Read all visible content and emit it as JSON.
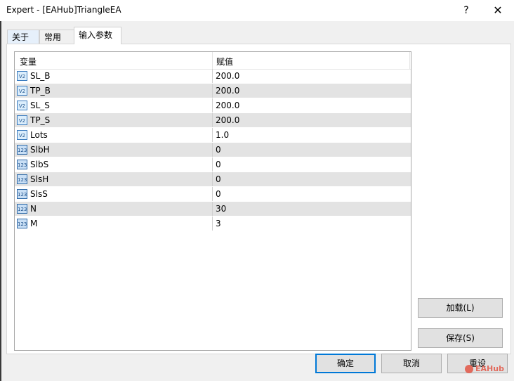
{
  "window": {
    "title": "Expert - [EAHub]TriangleEA",
    "help_label": "?",
    "close_label": "✕"
  },
  "tabs": [
    {
      "label": "关于"
    },
    {
      "label": "常用"
    },
    {
      "label": "输入参数"
    }
  ],
  "table": {
    "columns": [
      "变量",
      "赋值"
    ],
    "rows": [
      {
        "name": "SL_B",
        "value": "200.0",
        "icon": "double-param-icon",
        "icon_text": "V2"
      },
      {
        "name": "TP_B",
        "value": "200.0",
        "icon": "double-param-icon",
        "icon_text": "V2"
      },
      {
        "name": "SL_S",
        "value": "200.0",
        "icon": "double-param-icon",
        "icon_text": "V2"
      },
      {
        "name": "TP_S",
        "value": "200.0",
        "icon": "double-param-icon",
        "icon_text": "V2"
      },
      {
        "name": "Lots",
        "value": "1.0",
        "icon": "double-param-icon",
        "icon_text": "V2"
      },
      {
        "name": "SlbH",
        "value": "0",
        "icon": "integer-param-icon",
        "icon_text": "123"
      },
      {
        "name": "SlbS",
        "value": "0",
        "icon": "integer-param-icon",
        "icon_text": "123"
      },
      {
        "name": "SlsH",
        "value": "0",
        "icon": "integer-param-icon",
        "icon_text": "123"
      },
      {
        "name": "SlsS",
        "value": "0",
        "icon": "integer-param-icon",
        "icon_text": "123"
      },
      {
        "name": "N",
        "value": "30",
        "icon": "integer-param-icon",
        "icon_text": "123"
      },
      {
        "name": "M",
        "value": "3",
        "icon": "integer-param-icon",
        "icon_text": "123"
      }
    ]
  },
  "buttons": {
    "load": "加载(L)",
    "save": "保存(S)",
    "ok": "确定",
    "cancel": "取消",
    "reset": "重设"
  },
  "watermark": "EAHub"
}
